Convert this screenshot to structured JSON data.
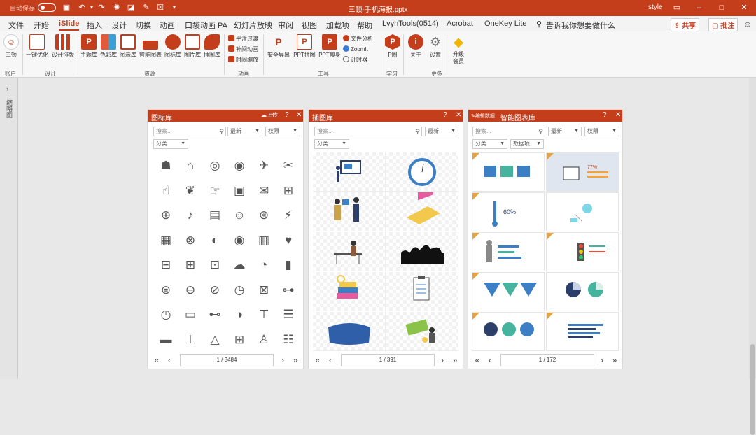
{
  "titlebar": {
    "autosave_label": "自动保存",
    "doc_title": "三顿-手机海报.pptx",
    "style_label": "style"
  },
  "menu": {
    "items": [
      "文件",
      "开始",
      "iSlide",
      "插入",
      "设计",
      "切换",
      "动画",
      "口袋动画 PA",
      "幻灯片放映",
      "审阅",
      "视图",
      "加载项",
      "帮助",
      "LvyhTools(0514)",
      "Acrobat",
      "OneKey Lite"
    ],
    "active": "iSlide",
    "tell_me": "告诉我你想要做什么",
    "share": "共享",
    "comment": "批注"
  },
  "ribbon": {
    "account_btn": "三顿",
    "account_group": "账户",
    "design_btns": [
      "一键优化",
      "设计排版"
    ],
    "design_group": "设计",
    "resource_btns": [
      "主题库",
      "色彩库",
      "图示库",
      "智能图表",
      "图标库",
      "图片库",
      "插图库"
    ],
    "resource_group": "资源",
    "anim_btns": [
      "平滑过渡",
      "补间动画",
      "时间缩放"
    ],
    "anim_group": "动画",
    "tool_btns": [
      "安全导出",
      "PPT拼图",
      "PPT瘦身"
    ],
    "tool_small": [
      "文件分析",
      "ZoomIt",
      "计时器"
    ],
    "tool_group": "工具",
    "learn_btn": "P圈",
    "learn_group": "学习",
    "more_btns": [
      "关于",
      "设置"
    ],
    "more_group": "更多",
    "upgrade_btn": "升级会员"
  },
  "leftbar": {
    "text": "缩略图"
  },
  "panel_icons": {
    "title": "图标库",
    "upload": "上传",
    "search_placeholder": "搜索...",
    "sort": "最新",
    "filter": "权限",
    "category": "分类",
    "page": "1 / 3484",
    "icons": [
      "☗",
      "⌂",
      "◎",
      "◉",
      "✈",
      "✂",
      "☝",
      "❦",
      "☞",
      "▣",
      "✉",
      "⊞",
      "⊕",
      "♪",
      "▤",
      "☺",
      "⊛",
      "⚡",
      "▦",
      "⊗",
      "◐",
      "◉",
      "▥",
      "♥",
      "⊟",
      "⊞",
      "⊡",
      "☁",
      "◔",
      "▮",
      "⊜",
      "⊖",
      "⊘",
      "◷",
      "⊠",
      "⊶",
      "◷",
      "▭",
      "⊷",
      "◑",
      "⊤",
      "☰",
      "▬",
      "⊥",
      "△",
      "⊞",
      "♙",
      "☷"
    ]
  },
  "panel_illustrations": {
    "title": "插图库",
    "search_placeholder": "搜索...",
    "sort": "最新",
    "category": "分类",
    "page": "1 / 391"
  },
  "panel_charts": {
    "title": "智能图表库",
    "edit": "编辑数据",
    "search_placeholder": "搜索...",
    "sort": "最新",
    "filter": "权限",
    "category": "分类",
    "subcategory": "数据项",
    "page": "1 / 172",
    "badges": [
      "60%",
      "77%"
    ]
  },
  "colors": {
    "accent": "#c43e1c",
    "panel_bg": "#ffffff"
  }
}
